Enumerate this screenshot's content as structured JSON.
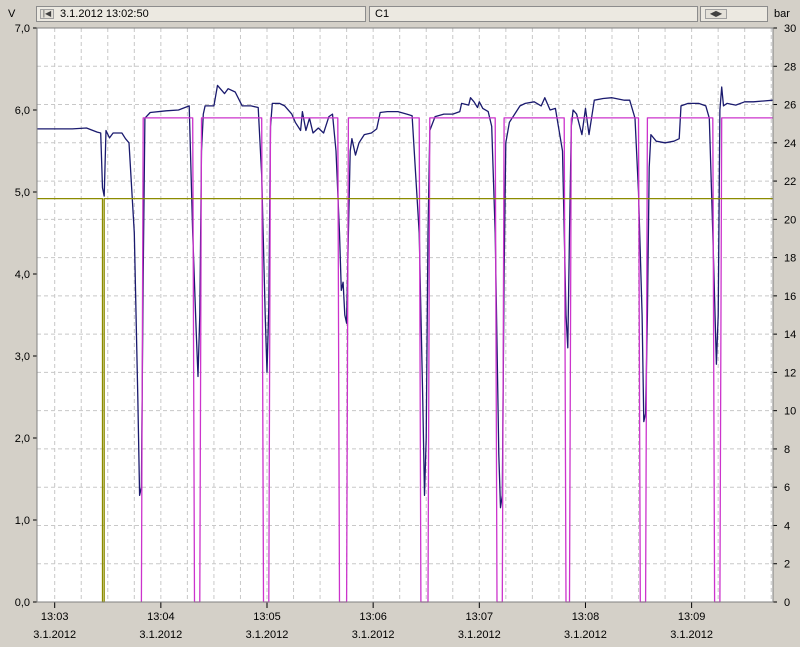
{
  "toolbar": {
    "timestamp": "3.1.2012 13:02:50",
    "channel": "C1",
    "first_icon": "skip-back-icon",
    "nav_icon": "scroll-left-right-icon"
  },
  "colors": {
    "background": "#d4d0c8",
    "plot_background": "#ffffff",
    "grid": "#c8c8c8",
    "voltage_series": "#1a1a6e",
    "pressure_series": "#cc33cc",
    "threshold_line": "#8c8c00"
  },
  "chart_data": {
    "type": "line",
    "left_axis": {
      "unit": "V",
      "ylim": [
        0,
        7
      ],
      "ticks": [
        0,
        1,
        2,
        3,
        4,
        5,
        6,
        7
      ],
      "tick_labels": [
        "0,0",
        "1,0",
        "2,0",
        "3,0",
        "4,0",
        "5,0",
        "6,0",
        "7,0"
      ]
    },
    "right_axis": {
      "unit": "bar",
      "ylim": [
        0,
        30
      ],
      "ticks": [
        0,
        2,
        4,
        6,
        8,
        10,
        12,
        14,
        16,
        18,
        20,
        22,
        24,
        26,
        28,
        30
      ],
      "tick_labels": [
        "0",
        "2",
        "4",
        "6",
        "8",
        "10",
        "12",
        "14",
        "16",
        "18",
        "20",
        "22",
        "24",
        "26",
        "28",
        "30"
      ]
    },
    "x_axis": {
      "range": [
        "13:02:50",
        "13:09:46"
      ],
      "tick_times": [
        "13:03",
        "13:04",
        "13:05",
        "13:06",
        "13:07",
        "13:08",
        "13:09"
      ],
      "tick_labels": [
        {
          "time": "13:03",
          "date": "3.1.2012"
        },
        {
          "time": "13:04",
          "date": "3.1.2012"
        },
        {
          "time": "13:05",
          "date": "3.1.2012"
        },
        {
          "time": "13:06",
          "date": "3.1.2012"
        },
        {
          "time": "13:07",
          "date": "3.1.2012"
        },
        {
          "time": "13:08",
          "date": "3.1.2012"
        },
        {
          "time": "13:09",
          "date": "3.1.2012"
        }
      ]
    },
    "grid": true,
    "series": [
      {
        "color": "#1a1a6e",
        "axis": "left",
        "points": [
          [
            "13:02:50",
            5.77
          ],
          [
            "13:03:10",
            5.77
          ],
          [
            "13:03:18",
            5.78
          ],
          [
            "13:03:24",
            5.73
          ],
          [
            "13:03:26",
            5.72
          ],
          [
            "13:03:27",
            5.05
          ],
          [
            "13:03:28",
            4.95
          ],
          [
            "13:03:29",
            5.75
          ],
          [
            "13:03:31",
            5.66
          ],
          [
            "13:03:33",
            5.72
          ],
          [
            "13:03:38",
            5.72
          ],
          [
            "13:03:40",
            5.65
          ],
          [
            "13:03:42",
            5.6
          ],
          [
            "13:03:45",
            4.5
          ],
          [
            "13:03:47",
            2.5
          ],
          [
            "13:03:48",
            1.3
          ],
          [
            "13:03:49",
            1.4
          ],
          [
            "13:03:50",
            4.0
          ],
          [
            "13:03:51",
            5.9
          ],
          [
            "13:03:54",
            5.97
          ],
          [
            "13:04:03",
            5.99
          ],
          [
            "13:04:10",
            6.0
          ],
          [
            "13:04:16",
            6.05
          ],
          [
            "13:04:18",
            4.5
          ],
          [
            "13:04:20",
            3.3
          ],
          [
            "13:04:21",
            2.75
          ],
          [
            "13:04:22",
            3.5
          ],
          [
            "13:04:23",
            5.5
          ],
          [
            "13:04:24",
            5.95
          ],
          [
            "13:04:25",
            6.05
          ],
          [
            "13:04:30",
            6.05
          ],
          [
            "13:04:32",
            6.3
          ],
          [
            "13:04:36",
            6.2
          ],
          [
            "13:04:38",
            6.26
          ],
          [
            "13:04:42",
            6.22
          ],
          [
            "13:04:46",
            6.05
          ],
          [
            "13:04:51",
            6.05
          ],
          [
            "13:04:55",
            6.03
          ],
          [
            "13:04:57",
            5.2
          ],
          [
            "13:04:59",
            3.5
          ],
          [
            "13:05:00",
            2.8
          ],
          [
            "13:05:01",
            3.6
          ],
          [
            "13:05:02",
            5.8
          ],
          [
            "13:05:03",
            6.08
          ],
          [
            "13:05:07",
            6.08
          ],
          [
            "13:05:10",
            6.05
          ],
          [
            "13:05:14",
            5.95
          ],
          [
            "13:05:16",
            5.85
          ],
          [
            "13:05:19",
            5.75
          ],
          [
            "13:05:20",
            5.98
          ],
          [
            "13:05:22",
            5.75
          ],
          [
            "13:05:24",
            5.9
          ],
          [
            "13:05:26",
            5.72
          ],
          [
            "13:05:29",
            5.78
          ],
          [
            "13:05:32",
            5.72
          ],
          [
            "13:05:35",
            5.92
          ],
          [
            "13:05:37",
            5.95
          ],
          [
            "13:05:39",
            5.5
          ],
          [
            "13:05:41",
            4.5
          ],
          [
            "13:05:42",
            3.8
          ],
          [
            "13:05:43",
            3.9
          ],
          [
            "13:05:44",
            3.5
          ],
          [
            "13:05:45",
            3.4
          ],
          [
            "13:05:46",
            4.5
          ],
          [
            "13:05:47",
            5.5
          ],
          [
            "13:05:48",
            5.65
          ],
          [
            "13:05:50",
            5.45
          ],
          [
            "13:05:52",
            5.6
          ],
          [
            "13:05:55",
            5.7
          ],
          [
            "13:05:59",
            5.72
          ],
          [
            "13:06:02",
            5.77
          ],
          [
            "13:06:04",
            5.97
          ],
          [
            "13:06:08",
            5.98
          ],
          [
            "13:06:14",
            5.98
          ],
          [
            "13:06:19",
            5.95
          ],
          [
            "13:06:22",
            5.93
          ],
          [
            "13:06:26",
            4.5
          ],
          [
            "13:06:28",
            2.5
          ],
          [
            "13:06:29",
            1.3
          ],
          [
            "13:06:30",
            2.0
          ],
          [
            "13:06:31",
            4.5
          ],
          [
            "13:06:32",
            5.75
          ],
          [
            "13:06:35",
            5.92
          ],
          [
            "13:06:40",
            5.95
          ],
          [
            "13:06:45",
            5.95
          ],
          [
            "13:06:49",
            5.98
          ],
          [
            "13:06:50",
            6.08
          ],
          [
            "13:06:54",
            6.06
          ],
          [
            "13:06:55",
            6.15
          ],
          [
            "13:06:57",
            6.1
          ],
          [
            "13:06:59",
            6.03
          ],
          [
            "13:07:00",
            6.1
          ],
          [
            "13:07:02",
            6.02
          ],
          [
            "13:07:05",
            5.98
          ],
          [
            "13:07:07",
            5.8
          ],
          [
            "13:07:09",
            4.5
          ],
          [
            "13:07:11",
            1.8
          ],
          [
            "13:07:12",
            1.15
          ],
          [
            "13:07:13",
            1.3
          ],
          [
            "13:07:14",
            4.0
          ],
          [
            "13:07:15",
            5.6
          ],
          [
            "13:07:17",
            5.85
          ],
          [
            "13:07:20",
            5.95
          ],
          [
            "13:07:23",
            6.05
          ],
          [
            "13:07:26",
            6.08
          ],
          [
            "13:07:31",
            6.1
          ],
          [
            "13:07:35",
            6.05
          ],
          [
            "13:07:37",
            6.15
          ],
          [
            "13:07:40",
            6.0
          ],
          [
            "13:07:43",
            6.02
          ],
          [
            "13:07:47",
            5.5
          ],
          [
            "13:07:49",
            3.5
          ],
          [
            "13:07:50",
            3.1
          ],
          [
            "13:07:51",
            4.5
          ],
          [
            "13:07:52",
            5.8
          ],
          [
            "13:07:53",
            6.0
          ],
          [
            "13:07:55",
            5.95
          ],
          [
            "13:07:58",
            5.7
          ],
          [
            "13:08:00",
            6.02
          ],
          [
            "13:08:02",
            5.7
          ],
          [
            "13:08:05",
            6.12
          ],
          [
            "13:08:10",
            6.14
          ],
          [
            "13:08:15",
            6.15
          ],
          [
            "13:08:22",
            6.12
          ],
          [
            "13:08:25",
            6.12
          ],
          [
            "13:08:28",
            5.9
          ],
          [
            "13:08:30",
            5.0
          ],
          [
            "13:08:32",
            3.5
          ],
          [
            "13:08:33",
            2.2
          ],
          [
            "13:08:34",
            2.3
          ],
          [
            "13:08:35",
            3.5
          ],
          [
            "13:08:36",
            5.3
          ],
          [
            "13:08:37",
            5.7
          ],
          [
            "13:08:40",
            5.62
          ],
          [
            "13:08:45",
            5.6
          ],
          [
            "13:08:50",
            5.62
          ],
          [
            "13:08:53",
            5.65
          ],
          [
            "13:08:54",
            6.05
          ],
          [
            "13:08:58",
            6.08
          ],
          [
            "13:09:04",
            6.08
          ],
          [
            "13:09:08",
            6.05
          ],
          [
            "13:09:10",
            5.9
          ],
          [
            "13:09:12",
            4.5
          ],
          [
            "13:09:14",
            2.9
          ],
          [
            "13:09:15",
            3.5
          ],
          [
            "13:09:16",
            6.0
          ],
          [
            "13:09:17",
            6.28
          ],
          [
            "13:09:18",
            6.05
          ],
          [
            "13:09:20",
            6.08
          ],
          [
            "13:09:25",
            6.06
          ],
          [
            "13:09:30",
            6.1
          ],
          [
            "13:09:35",
            6.1
          ],
          [
            "13:09:46",
            6.12
          ]
        ]
      },
      {
        "color": "#cc33cc",
        "axis": "right",
        "points": [
          [
            "13:03:49",
            0
          ],
          [
            "13:03:50",
            25.3
          ],
          [
            "13:04:18",
            25.3
          ],
          [
            "13:04:19",
            0
          ],
          [
            "13:04:22",
            0
          ],
          [
            "13:04:23",
            25.3
          ],
          [
            "13:04:57",
            25.3
          ],
          [
            "13:04:58",
            0
          ],
          [
            "13:05:01",
            0
          ],
          [
            "13:05:02",
            25.3
          ],
          [
            "13:05:40",
            25.3
          ],
          [
            "13:05:41",
            0
          ],
          [
            "13:05:45",
            0
          ],
          [
            "13:05:46",
            25.3
          ],
          [
            "13:06:26",
            25.3
          ],
          [
            "13:06:27",
            0
          ],
          [
            "13:06:31",
            0
          ],
          [
            "13:06:32",
            25.3
          ],
          [
            "13:07:09",
            25.3
          ],
          [
            "13:07:10",
            0
          ],
          [
            "13:07:13",
            0
          ],
          [
            "13:07:14",
            25.3
          ],
          [
            "13:07:48",
            25.3
          ],
          [
            "13:07:49",
            0
          ],
          [
            "13:07:51",
            0
          ],
          [
            "13:07:52",
            25.3
          ],
          [
            "13:08:30",
            25.3
          ],
          [
            "13:08:31",
            0
          ],
          [
            "13:08:34",
            0
          ],
          [
            "13:08:35",
            25.3
          ],
          [
            "13:09:12",
            25.3
          ],
          [
            "13:09:13",
            0
          ],
          [
            "13:09:16",
            0
          ],
          [
            "13:09:17",
            25.3
          ],
          [
            "13:09:46",
            25.3
          ]
        ]
      },
      {
        "color": "#8c8c00",
        "axis": "left",
        "points": [
          [
            "13:02:50",
            4.92
          ],
          [
            "13:03:27",
            4.92
          ],
          [
            "13:03:27",
            0
          ],
          [
            "13:03:28",
            0
          ],
          [
            "13:03:28",
            4.92
          ],
          [
            "13:09:46",
            4.92
          ]
        ]
      }
    ]
  }
}
